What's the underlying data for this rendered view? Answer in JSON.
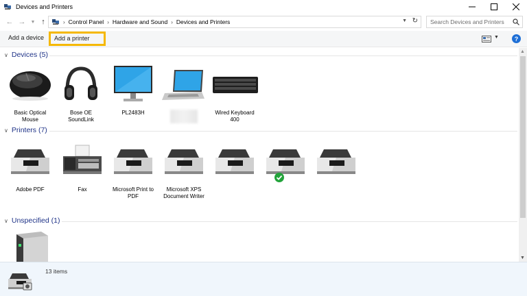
{
  "window": {
    "title": "Devices and Printers",
    "controls": [
      "minimize-icon",
      "maximize-icon",
      "close-icon"
    ]
  },
  "address": {
    "breadcrumbs": [
      "Control Panel",
      "Hardware and Sound",
      "Devices and Printers"
    ],
    "search_placeholder": "Search Devices and Printers"
  },
  "commands": {
    "add_device": "Add a device",
    "add_printer": "Add a printer",
    "help": "?"
  },
  "sections": {
    "devices": {
      "header": "Devices (5)",
      "items": [
        {
          "label": "Basic Optical Mouse",
          "icon": "mouse-icon"
        },
        {
          "label": "Bose OE SoundLink",
          "icon": "headphones-icon"
        },
        {
          "label": "PL2483H",
          "icon": "monitor-icon"
        },
        {
          "label": "",
          "icon": "laptop-icon"
        },
        {
          "label": "Wired Keyboard 400",
          "icon": "keyboard-icon"
        }
      ]
    },
    "printers": {
      "header": "Printers (7)",
      "items": [
        {
          "label": "Adobe PDF",
          "icon": "printer-icon"
        },
        {
          "label": "Fax",
          "icon": "fax-icon"
        },
        {
          "label": "Microsoft Print to PDF",
          "icon": "printer-icon"
        },
        {
          "label": "Microsoft XPS Document Writer",
          "icon": "printer-icon"
        },
        {
          "label": "",
          "icon": "printer-icon"
        },
        {
          "label": "",
          "icon": "printer-icon",
          "default": true
        },
        {
          "label": "",
          "icon": "printer-icon"
        }
      ]
    },
    "unspecified": {
      "header": "Unspecified (1)",
      "items": [
        {
          "label": "",
          "icon": "server-icon"
        }
      ]
    }
  },
  "details": {
    "count": "13 items"
  },
  "colors": {
    "highlight": "#f5b800",
    "section_header": "#1e3287",
    "help": "#1e6fd6",
    "default_check": "#22a33a"
  }
}
